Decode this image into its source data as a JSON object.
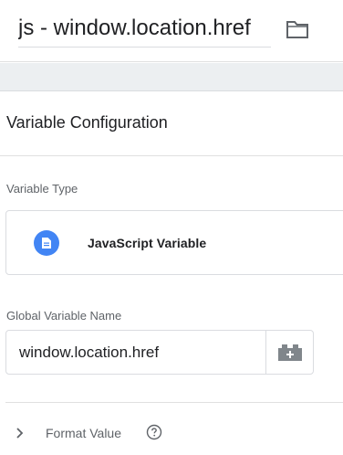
{
  "header": {
    "title": "js - window.location.href",
    "folder_icon": "folder-icon"
  },
  "config": {
    "title": "Variable Configuration",
    "variable_type_label": "Variable Type",
    "variable_type": {
      "name": "JavaScript Variable",
      "icon": "document-icon",
      "icon_color": "#4285f4"
    },
    "global_variable_label": "Global Variable Name",
    "global_variable_value": "window.location.href",
    "insert_variable_icon": "lego-brick-icon",
    "format_value_label": "Format Value",
    "format_chevron_icon": "chevron-right-icon",
    "help_icon": "help-circle-icon"
  }
}
